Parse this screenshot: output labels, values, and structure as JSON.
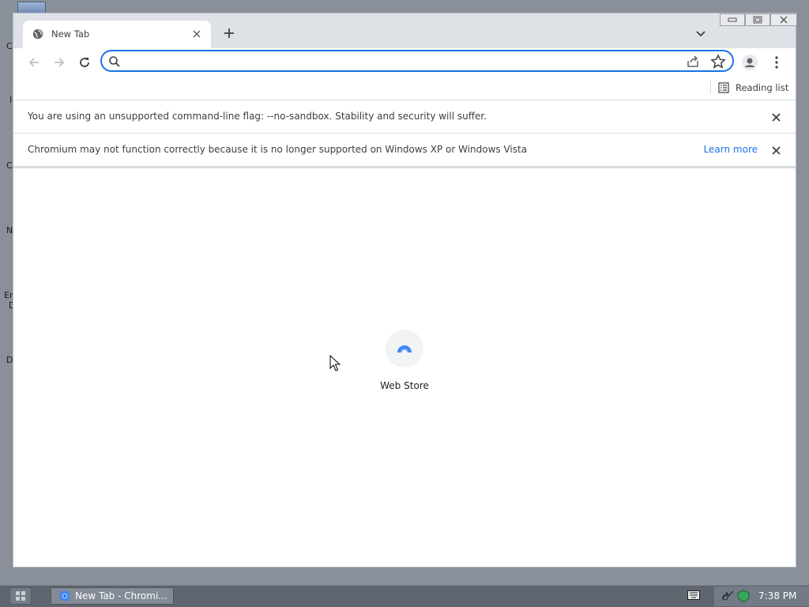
{
  "desktop": {
    "icon_glyphs": [
      "C",
      "I",
      "C",
      "N",
      "Er",
      "D",
      "D"
    ]
  },
  "browser": {
    "tab": {
      "title": "New Tab"
    },
    "window_controls": [
      "minimize",
      "restore",
      "close"
    ],
    "omnibox": {
      "value": "",
      "placeholder": ""
    },
    "bookmarks_bar": {
      "reading_list_label": "Reading list"
    },
    "infobars": [
      {
        "text": "You are using an unsupported command-line flag: --no-sandbox. Stability and security will suffer.",
        "link": ""
      },
      {
        "text": "Chromium may not function correctly because it is no longer supported on Windows XP or Windows Vista",
        "link": "Learn more"
      }
    ],
    "shortcuts": [
      {
        "label": "Web Store",
        "icon": "web-store-icon"
      }
    ]
  },
  "taskbar": {
    "task_label": "New Tab - Chromi...",
    "clock": "7:38 PM"
  },
  "colors": {
    "accent": "#1a73e8",
    "tabstrip": "#dee1e6",
    "desktop": "#8a909a",
    "taskbar": "#5f6670"
  }
}
